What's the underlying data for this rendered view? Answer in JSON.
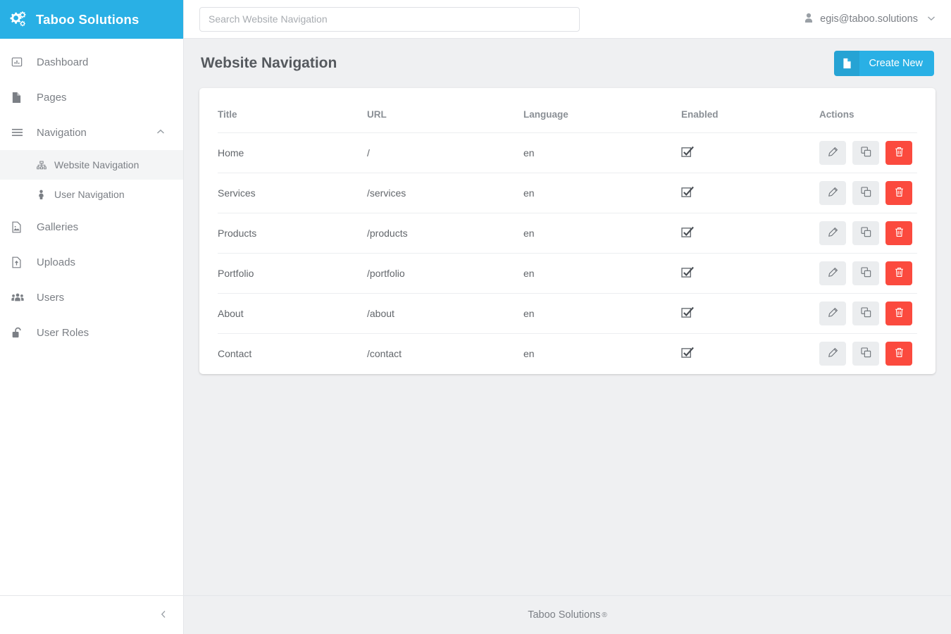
{
  "brand": {
    "title": "Taboo Solutions",
    "icon": "cogs-icon",
    "color": "#29b0e5"
  },
  "sidebar": {
    "items": [
      {
        "label": "Dashboard",
        "icon": "dashboard-icon"
      },
      {
        "label": "Pages",
        "icon": "file-icon"
      },
      {
        "label": "Navigation",
        "icon": "bars-icon",
        "expanded": true,
        "caret": "⌃"
      },
      {
        "label": "Galleries",
        "icon": "image-file-icon"
      },
      {
        "label": "Uploads",
        "icon": "file-upload-icon"
      },
      {
        "label": "Users",
        "icon": "users-icon"
      },
      {
        "label": "User Roles",
        "icon": "unlock-icon"
      }
    ],
    "subitems": [
      {
        "label": "Website Navigation",
        "icon": "sitemap-icon",
        "active": true
      },
      {
        "label": "User Navigation",
        "icon": "male-user-icon",
        "active": false
      }
    ],
    "collapse_icon": "chevron-left-icon"
  },
  "topbar": {
    "search": {
      "placeholder": "Search Website Navigation",
      "value": ""
    },
    "user": {
      "email": "egis@taboo.solutions",
      "avatar_icon": "user-icon",
      "chevron": "⌄"
    }
  },
  "page": {
    "title": "Website Navigation",
    "create_button": {
      "label": "Create New",
      "icon": "file-icon"
    }
  },
  "table": {
    "columns": [
      "Title",
      "URL",
      "Language",
      "Enabled",
      "Actions"
    ],
    "rows": [
      {
        "title": "Home",
        "url": "/",
        "language": "en",
        "enabled": true
      },
      {
        "title": "Services",
        "url": "/services",
        "language": "en",
        "enabled": true
      },
      {
        "title": "Products",
        "url": "/products",
        "language": "en",
        "enabled": true
      },
      {
        "title": "Portfolio",
        "url": "/portfolio",
        "language": "en",
        "enabled": true
      },
      {
        "title": "About",
        "url": "/about",
        "language": "en",
        "enabled": true
      },
      {
        "title": "Contact",
        "url": "/contact",
        "language": "en",
        "enabled": true
      }
    ],
    "row_actions": [
      {
        "name": "edit",
        "icon": "pencil-icon",
        "style": "light"
      },
      {
        "name": "duplicate",
        "icon": "copy-icon",
        "style": "light"
      },
      {
        "name": "delete",
        "icon": "trash-icon",
        "style": "danger"
      }
    ]
  },
  "footer": {
    "text": "Taboo Solutions",
    "mark": "®"
  },
  "colors": {
    "brand_blue": "#29b0e5",
    "danger_red": "#fb4a3e",
    "page_bg": "#eff0f2",
    "light_btn": "#ebedef"
  }
}
